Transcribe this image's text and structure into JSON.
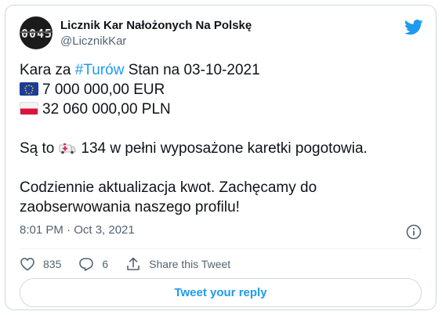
{
  "account": {
    "name": "Licznik Kar Nałożonych Na Polskę",
    "handle": "@LicznikKar",
    "avatar_digits": [
      "0",
      "0",
      "4",
      "5"
    ]
  },
  "tweet": {
    "line1_prefix": "Kara za ",
    "line1_hashtag": "#Turów",
    "line1_suffix": " Stan na 03-10-2021",
    "eur_amount": "7 000 000,00 EUR",
    "pln_amount": "32 060 000,00 PLN",
    "line4_prefix": "Są to",
    "line4_suffix": "134 w pełni wyposażone karetki pogotowia.",
    "line5": "Codziennie aktualizacja kwot. Zachęcamy do",
    "line6": "zaobserwowania naszego profilu!"
  },
  "meta": {
    "timestamp": "8:01 PM · Oct 3, 2021"
  },
  "actions": {
    "likes": "835",
    "replies": "6",
    "share_label": "Share this Tweet"
  },
  "reply_button": "Tweet your reply",
  "icons": {
    "brand": "twitter-bird-icon",
    "info": "info-icon",
    "like": "heart-icon",
    "reply": "comment-icon",
    "share": "share-icon",
    "flag_eu": "eu-flag-icon",
    "flag_pl": "poland-flag-icon",
    "ambulance": "ambulance-icon"
  },
  "colors": {
    "accent": "#1d9bf0",
    "text": "#0f1419",
    "muted": "#536471",
    "border": "#cfd9de"
  }
}
